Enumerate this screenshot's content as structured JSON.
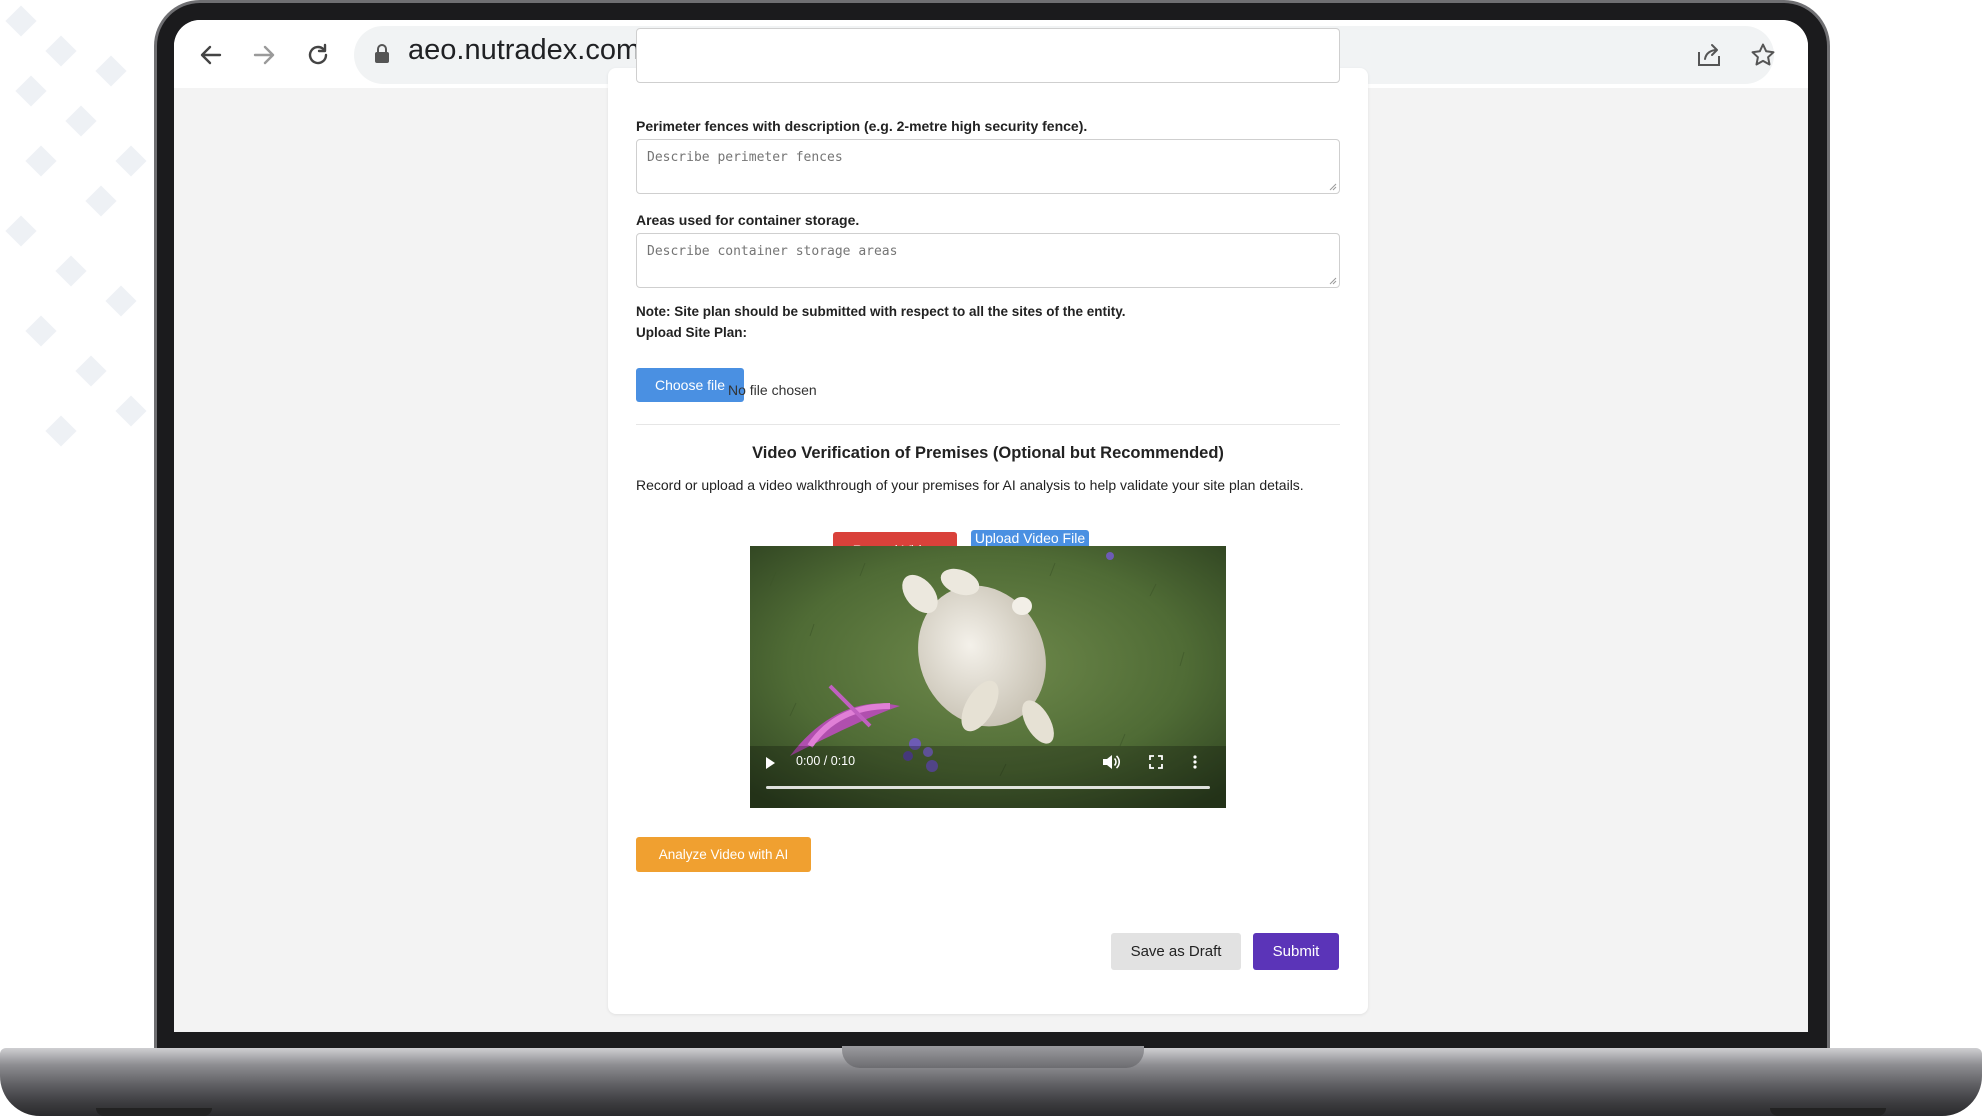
{
  "browser": {
    "url": "aeo.nutradex.com",
    "icons": [
      "back-arrow-icon",
      "forward-arrow-icon",
      "reload-icon",
      "lock-icon",
      "share-icon",
      "star-icon"
    ]
  },
  "form": {
    "perimeter_label": "Perimeter fences with description (e.g. 2-metre high security fence).",
    "perimeter_placeholder": "Describe perimeter fences",
    "storage_label": "Areas used for container storage.",
    "storage_placeholder": "Describe container storage areas",
    "site_plan_note": "Note: Site plan should be submitted with respect to all the sites of the entity.",
    "upload_label": "Upload Site Plan:",
    "choose_file_label": "Choose file",
    "file_status": "No file chosen"
  },
  "video_section": {
    "title": "Video Verification of Premises (Optional but Recommended)",
    "description": "Record or upload a video walkthrough of your premises for AI analysis to help validate your site plan details.",
    "record_label": "Record Video",
    "upload_label": "Upload Video File",
    "player": {
      "time": "0:00 / 0:10",
      "progress": 0
    },
    "analyze_label": "Analyze Video with AI"
  },
  "actions": {
    "save_draft_label": "Save as Draft",
    "submit_label": "Submit"
  },
  "colors": {
    "choose_file": "#4a90e2",
    "record": "#d9413a",
    "upload": "#4a90e2",
    "analyze": "#f0a030",
    "save_draft": "#e2e2e2",
    "submit": "#5b34b8"
  }
}
